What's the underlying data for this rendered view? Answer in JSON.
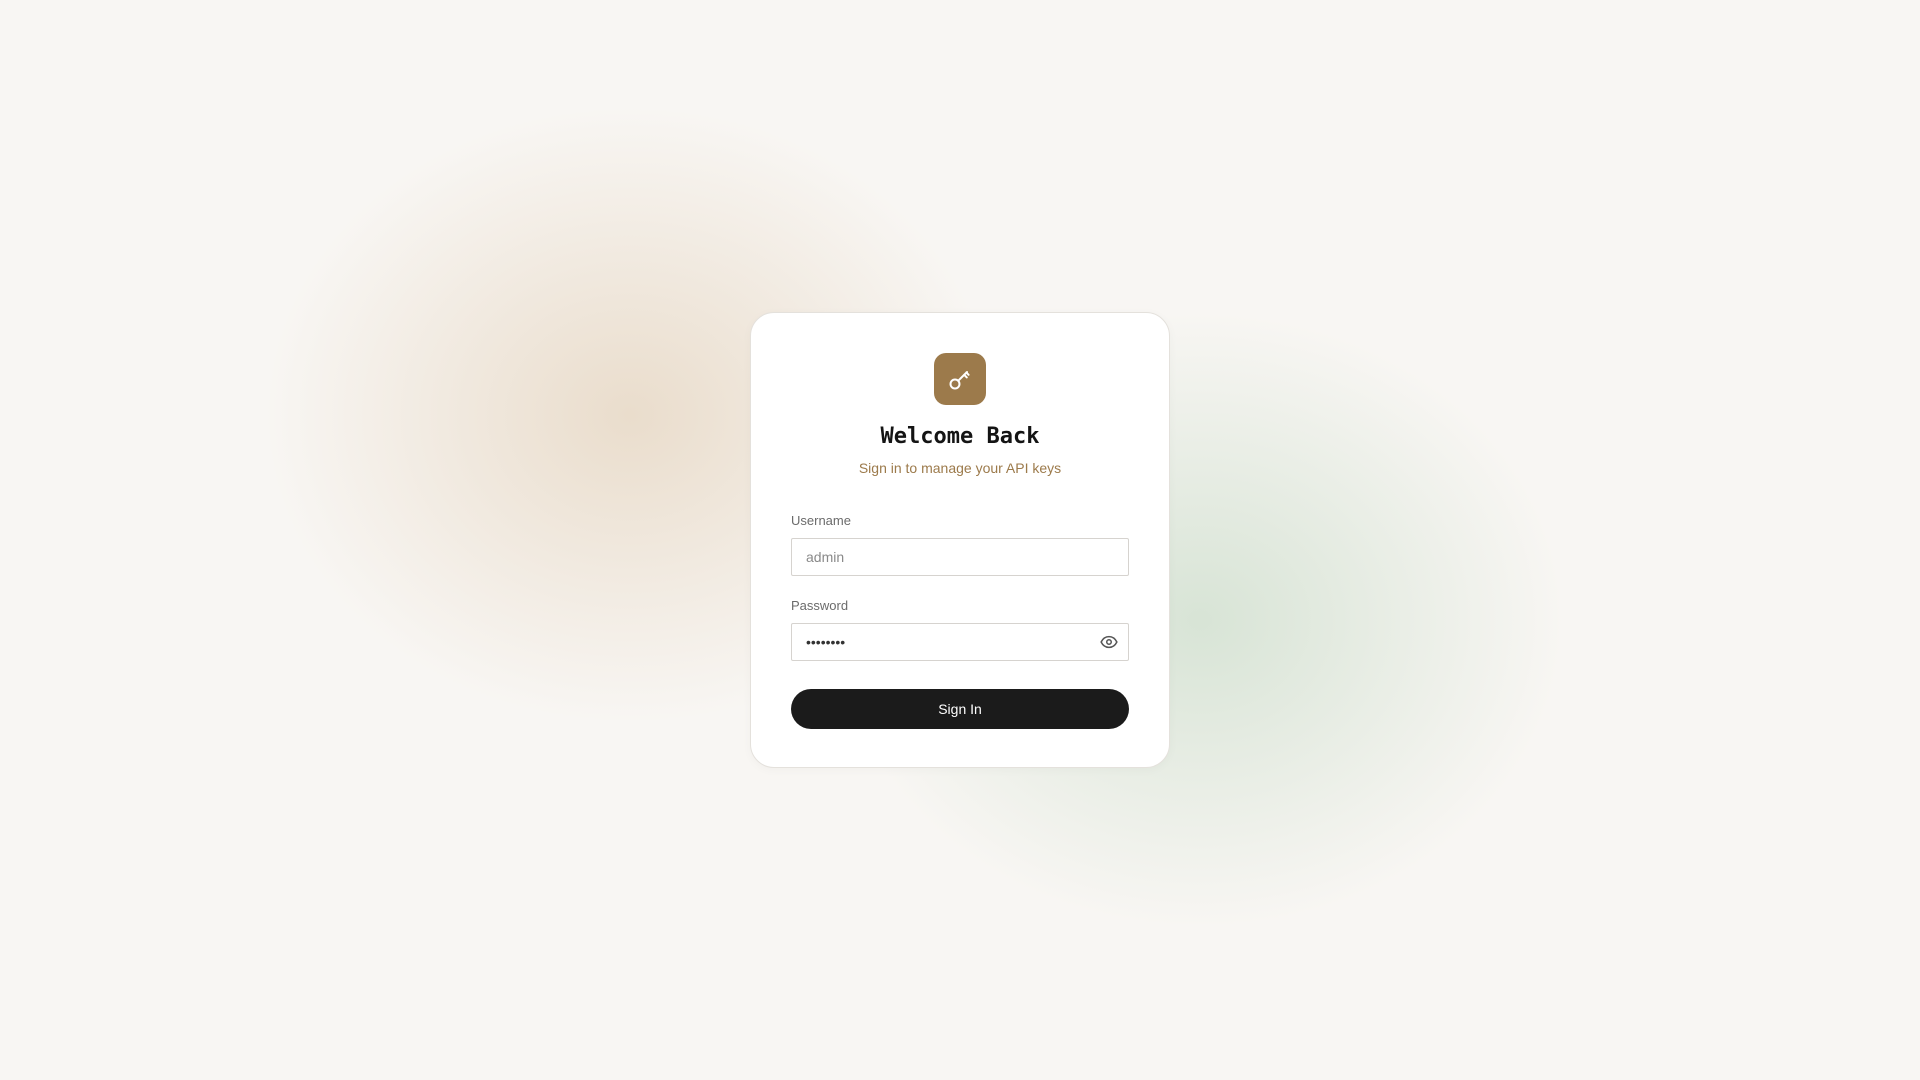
{
  "login": {
    "logo_icon": "key-icon",
    "title": "Welcome Back",
    "subtitle": "Sign in to manage your API keys",
    "username": {
      "label": "Username",
      "placeholder": "admin",
      "value": ""
    },
    "password": {
      "label": "Password",
      "value": "••••••••",
      "toggle_icon": "eye-icon"
    },
    "submit_label": "Sign In"
  },
  "colors": {
    "background": "#f8f6f3",
    "accent": "#9c7a4b",
    "button": "#1b1b1b",
    "card": "#ffffff"
  }
}
